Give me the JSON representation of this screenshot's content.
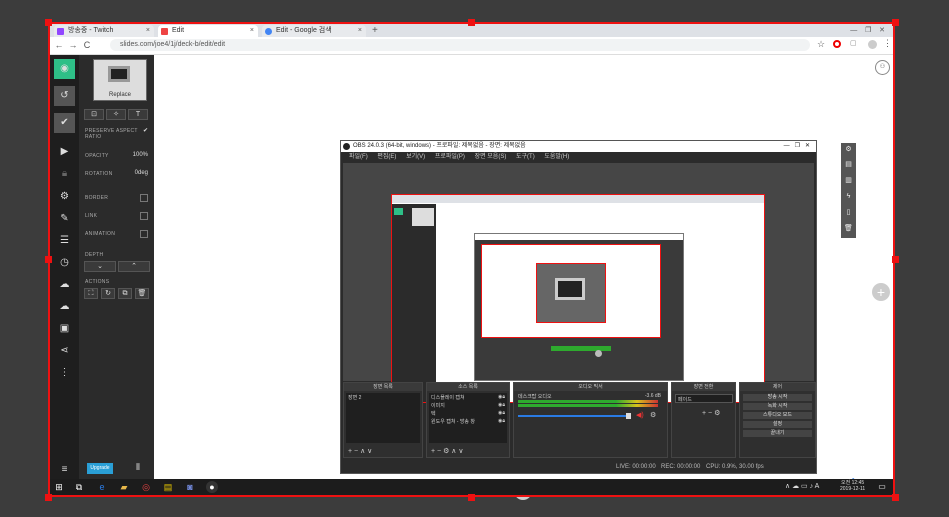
{
  "browser": {
    "tabs": [
      {
        "label": "방송중 - Twitch",
        "color": "#9146ff"
      },
      {
        "label": "Edit",
        "color": "#e44"
      },
      {
        "label": "Edit - Google 검색",
        "color": "#4285f4"
      }
    ],
    "new_tab": "+",
    "url": "slides.com/joe4/1j/deck-b/edit/edit",
    "back": "←",
    "forward": "→",
    "reload": "C"
  },
  "slides": {
    "thumb_label": "Replace",
    "opacity_label": "OPACITY",
    "opacity_value": "100%",
    "rotation_label": "ROTATION",
    "rotation_value": "0deg",
    "border_label": "BORDER",
    "link_label": "LINK",
    "animation_label": "ANIMATION",
    "depth_label": "DEPTH",
    "actions_label": "ACTIONS",
    "preserve_label": "PRESERVE ASPECT RATIO",
    "upgrade_label": "Upgrade"
  },
  "obs": {
    "title": "OBS 24.0.3 (64-bit, windows) - 프로파일: 제목없음 - 장면: 제목없음",
    "menu": [
      "파일(F)",
      "편집(E)",
      "보기(V)",
      "프로파일(P)",
      "장면 모음(S)",
      "도구(T)",
      "도움말(H)"
    ],
    "docks": {
      "scenes": {
        "title": "장면 목록",
        "items": [
          "장면 2"
        ]
      },
      "sources": {
        "title": "소스 목록",
        "items": [
          "디스플레이 캡쳐",
          "이미지",
          "텍",
          "윈도우 캡쳐 - 방송 창"
        ]
      },
      "mixer": {
        "title": "오디오 믹서",
        "channel": "데스크탑 오디오",
        "db": "-3.6 dB"
      },
      "transitions": {
        "title": "장면 전환",
        "value": "페이드"
      },
      "controls": {
        "title": "제어",
        "buttons": [
          "방송 시작",
          "녹화 시작",
          "스튜디오 모드",
          "설정",
          "끝내기"
        ]
      }
    },
    "status": {
      "live": "LIVE: 00:00:00",
      "rec": "REC: 00:00:00",
      "cpu": "CPU: 0.9%, 30.00 fps"
    }
  },
  "taskbar": {
    "time": "오전 12:45",
    "date": "2019-12-11",
    "ime": "A"
  }
}
